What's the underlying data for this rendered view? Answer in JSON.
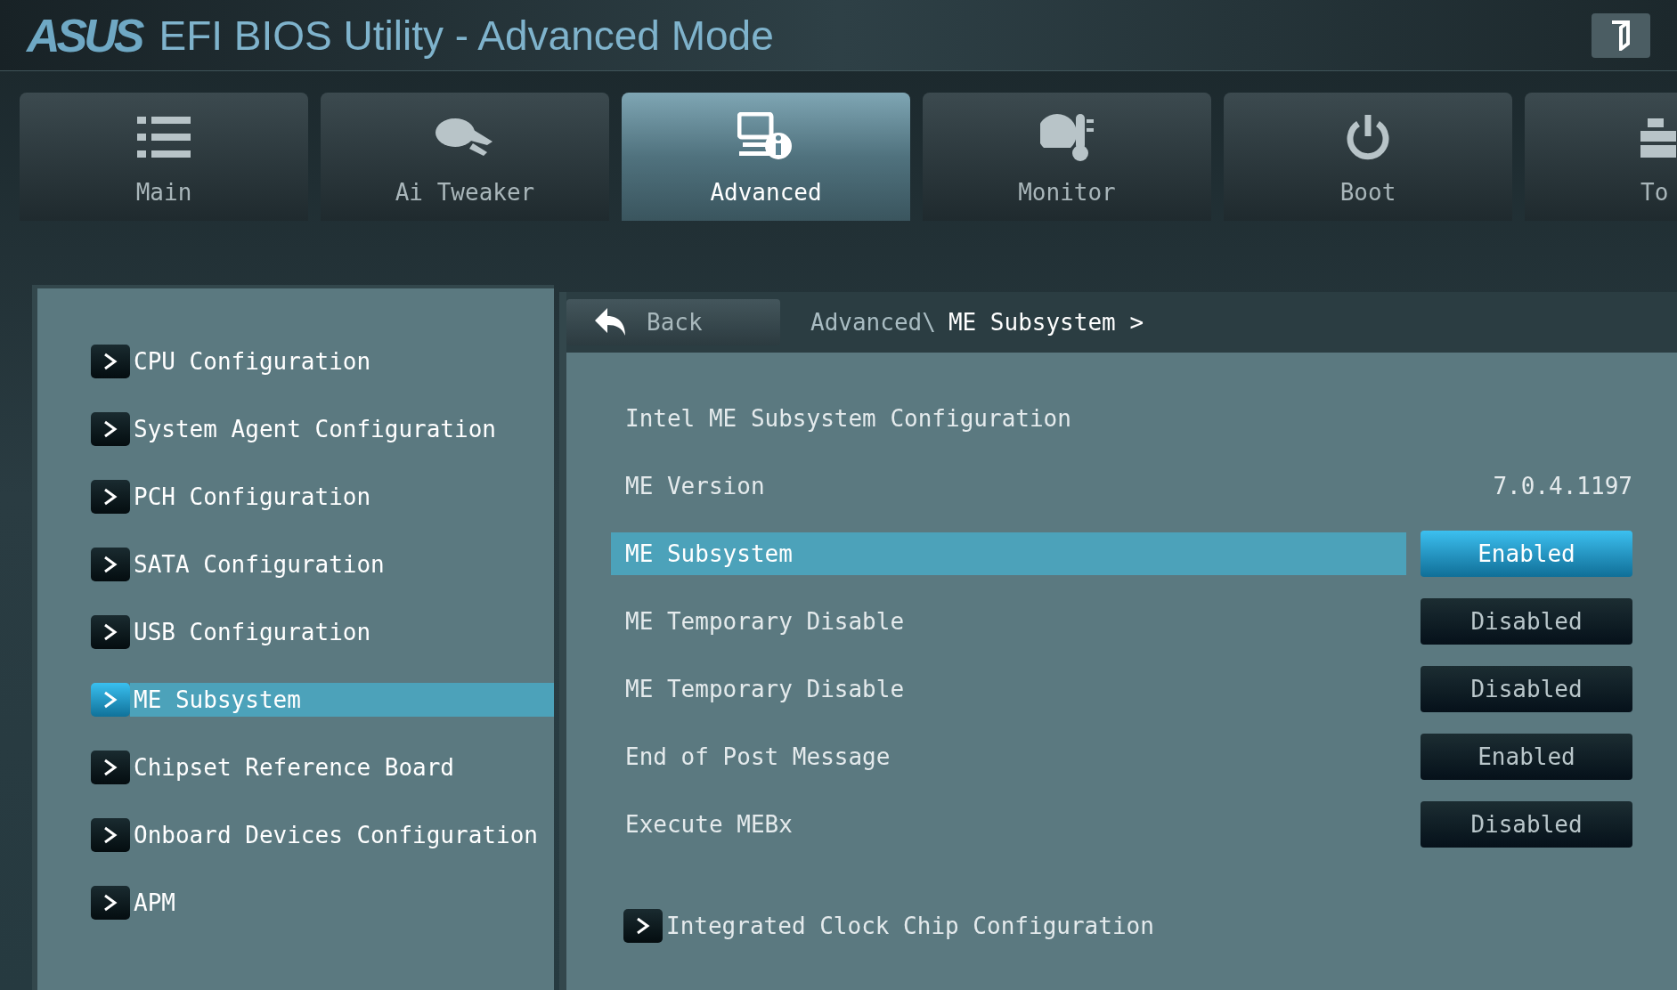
{
  "window": {
    "logo": "ASUS",
    "title": "EFI BIOS Utility - Advanced Mode"
  },
  "tabs": [
    {
      "label": "Main",
      "selected": false
    },
    {
      "label": "Ai Tweaker",
      "selected": false
    },
    {
      "label": "Advanced",
      "selected": true
    },
    {
      "label": "Monitor",
      "selected": false
    },
    {
      "label": "Boot",
      "selected": false
    },
    {
      "label": "To",
      "selected": false
    }
  ],
  "sidebar": {
    "items": [
      {
        "label": "CPU Configuration",
        "selected": false
      },
      {
        "label": "System Agent Configuration",
        "selected": false
      },
      {
        "label": "PCH Configuration",
        "selected": false
      },
      {
        "label": "SATA Configuration",
        "selected": false
      },
      {
        "label": "USB Configuration",
        "selected": false
      },
      {
        "label": "ME Subsystem",
        "selected": true
      },
      {
        "label": "Chipset Reference Board",
        "selected": false
      },
      {
        "label": "Onboard Devices Configuration",
        "selected": false
      },
      {
        "label": "APM",
        "selected": false
      }
    ]
  },
  "nav": {
    "back": "Back",
    "breadcrumb_parent": "Advanced\\",
    "breadcrumb_current": "ME Subsystem >"
  },
  "settings": [
    {
      "kind": "heading",
      "label": "Intel ME Subsystem Configuration"
    },
    {
      "kind": "info",
      "label": "ME Version",
      "value": "7.0.4.1197"
    },
    {
      "kind": "option",
      "label": "ME Subsystem",
      "value": "Enabled",
      "selected": true
    },
    {
      "kind": "option",
      "label": "ME Temporary Disable",
      "value": "Disabled",
      "selected": false
    },
    {
      "kind": "option",
      "label": "ME Temporary Disable",
      "value": "Disabled",
      "selected": false
    },
    {
      "kind": "option",
      "label": "End of Post Message",
      "value": "Enabled",
      "selected": false
    },
    {
      "kind": "option",
      "label": "Execute MEBx",
      "value": "Disabled",
      "selected": false
    },
    {
      "kind": "submenu",
      "label": "Integrated Clock Chip Configuration"
    }
  ]
}
